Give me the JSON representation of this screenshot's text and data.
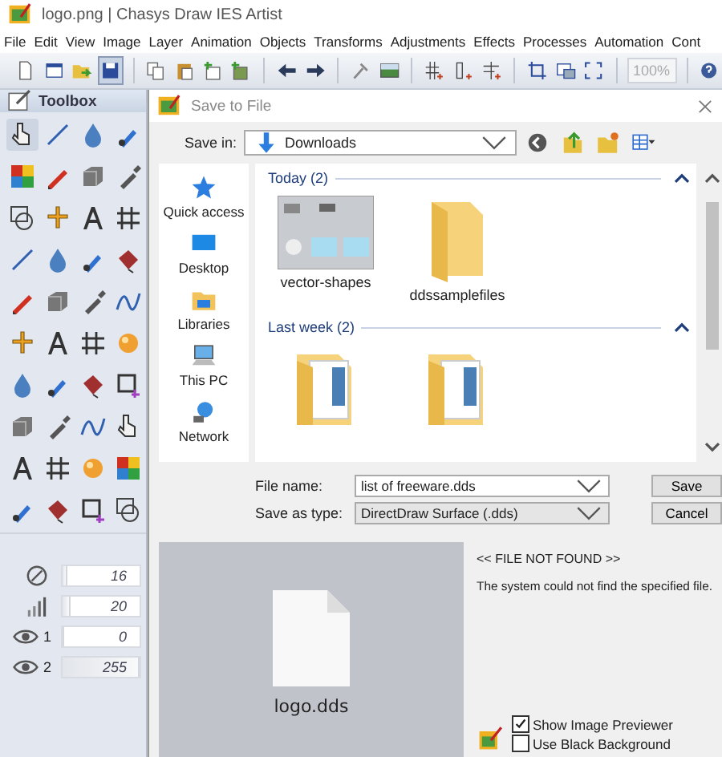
{
  "window": {
    "title": "logo.png | Chasys Draw IES Artist"
  },
  "menu": [
    "File",
    "Edit",
    "View",
    "Image",
    "Layer",
    "Animation",
    "Objects",
    "Transforms",
    "Adjustments",
    "Effects",
    "Processes",
    "Automation",
    "Cont"
  ],
  "toolbar": {
    "zoom": "100%",
    "zoom_disabled": true
  },
  "toolbox": {
    "title": "Toolbox",
    "properties": [
      {
        "kind": "size",
        "value": "16",
        "level": 0.06
      },
      {
        "kind": "strength",
        "value": "20",
        "level": 0.1
      },
      {
        "kind": "eye",
        "label": "1",
        "value": "0",
        "level": 0
      },
      {
        "kind": "eye",
        "label": "2",
        "value": "255",
        "level": 1
      }
    ]
  },
  "dialog": {
    "title": "Save to File",
    "save_in_label": "Save in:",
    "save_in": "Downloads",
    "places": [
      {
        "kind": "star",
        "label": "Quick access"
      },
      {
        "kind": "desktop",
        "label": "Desktop"
      },
      {
        "kind": "library",
        "label": "Libraries"
      },
      {
        "kind": "pc",
        "label": "This PC"
      },
      {
        "kind": "network",
        "label": "Network"
      }
    ],
    "groups": [
      {
        "label": "Today (2)",
        "items": [
          {
            "kind": "image",
            "label": "vector-shapes"
          },
          {
            "kind": "folder",
            "label": "ddssamplefiles"
          }
        ]
      },
      {
        "label": "Last week (2)",
        "items": [
          {
            "kind": "folder-doc"
          },
          {
            "kind": "folder-doc"
          }
        ]
      }
    ],
    "file_name_label": "File name:",
    "file_name": "list of freeware.dds",
    "type_label": "Save as type:",
    "type": "DirectDraw Surface (.dds)",
    "buttons": [
      "Save",
      "Cancel"
    ],
    "preview": {
      "file": "logo.dds",
      "status": "<< FILE NOT FOUND >>",
      "message": "The system could not find the specified file.",
      "options": [
        {
          "label": "Show Image Previewer",
          "checked": true
        },
        {
          "label": "Use Black Background",
          "checked": false
        }
      ]
    }
  }
}
